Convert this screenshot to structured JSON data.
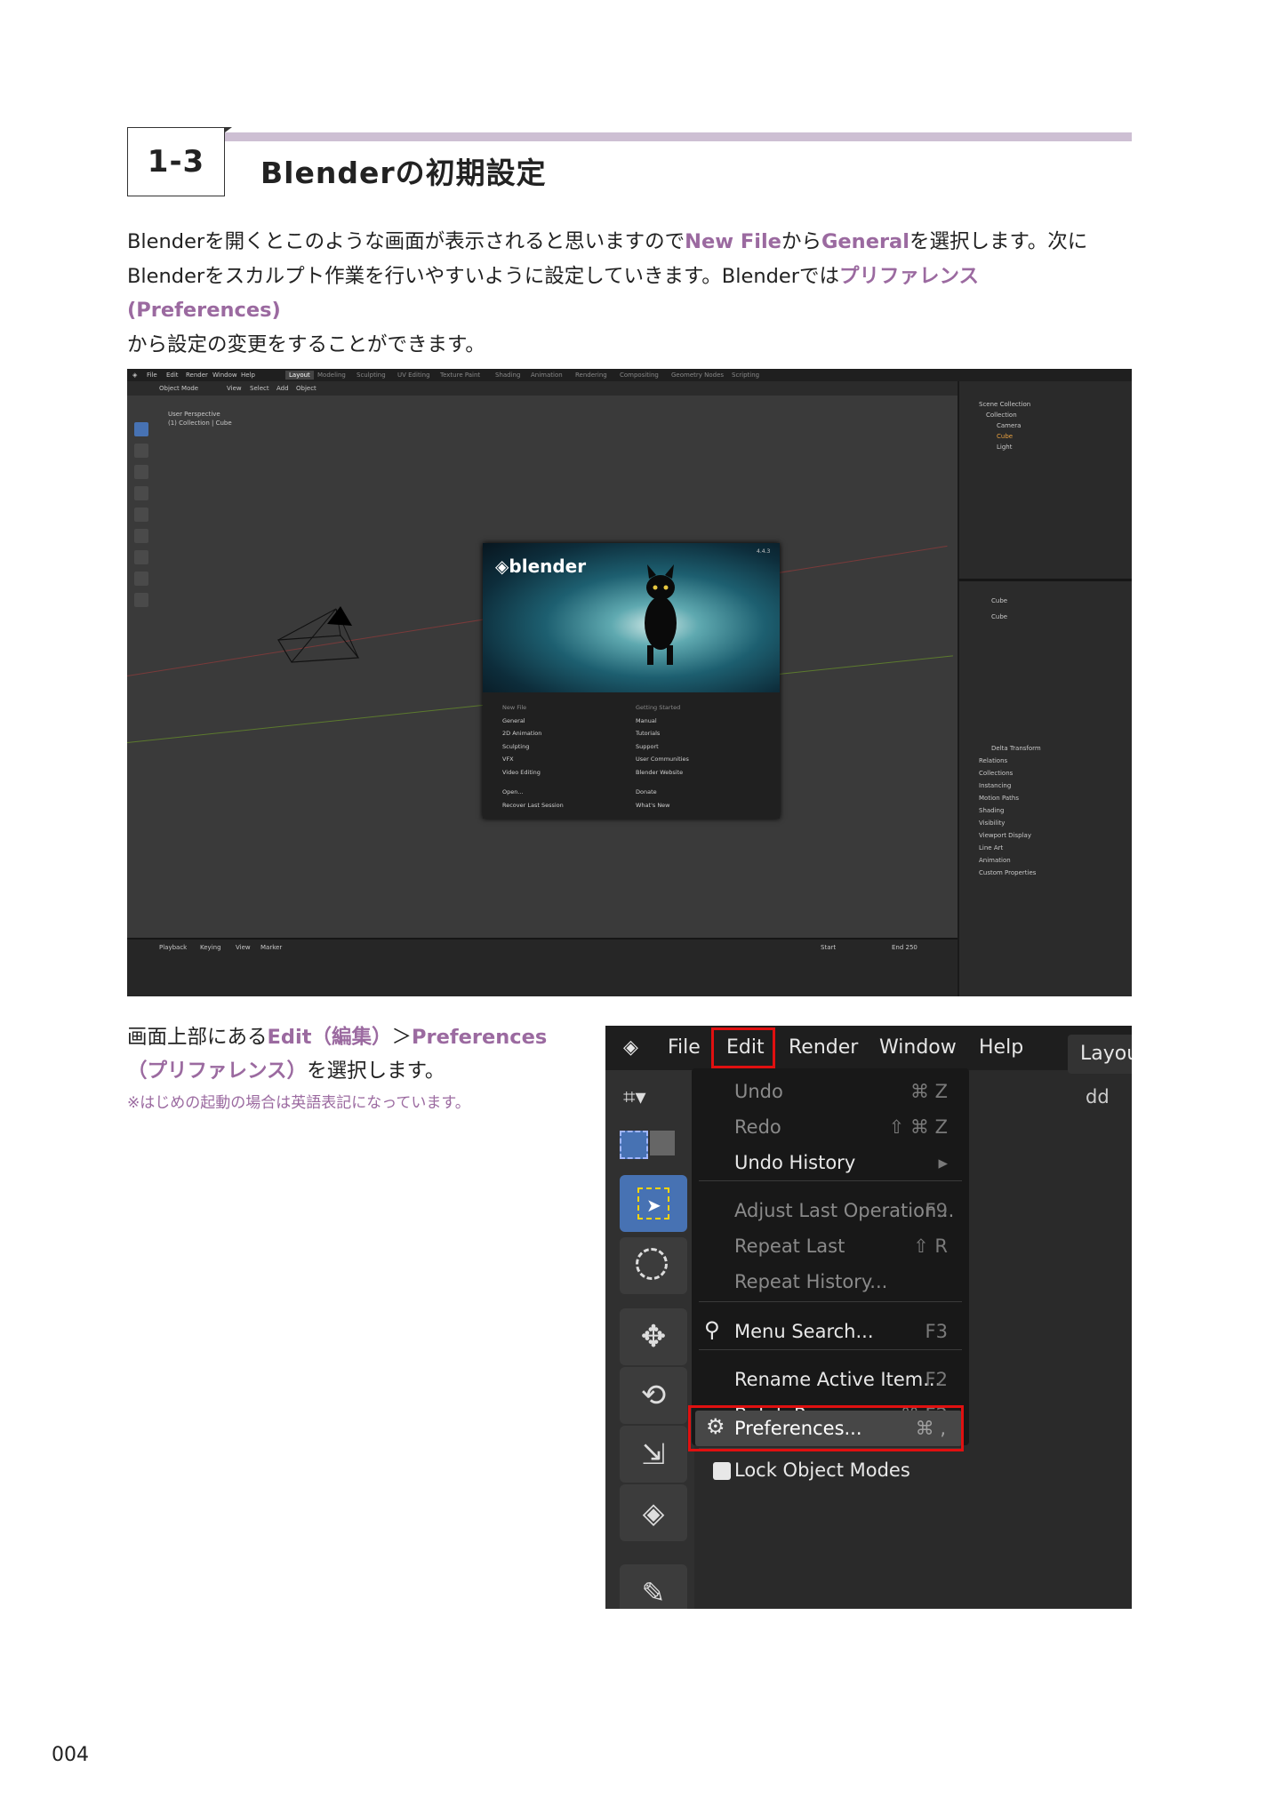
{
  "section": {
    "number": "1-3",
    "title": "Blenderの初期設定"
  },
  "intro": {
    "t1": "Blenderを開くとこのような画面が表示されると思いますので",
    "h1": "New File",
    "t2": "から",
    "h2": "General",
    "t3": "を選択します。次にBlenderをスカルプト作業を行いやすいように設定していきます。Blenderでは",
    "h3": "プリファレンス(Preferences)",
    "t4": "から設定の変更をすることができます。"
  },
  "screenshot1": {
    "topbar_menus": [
      "File",
      "Edit",
      "Render",
      "Window",
      "Help"
    ],
    "workspace_tabs": [
      "Layout",
      "Modeling",
      "Sculpting",
      "UV Editing",
      "Texture Paint",
      "Shading",
      "Animation",
      "Rendering",
      "Compositing",
      "Geometry Nodes",
      "Scripting"
    ],
    "header_items": [
      "Object Mode",
      "View",
      "Select",
      "Add",
      "Object"
    ],
    "viewport_label_1": "User Perspective",
    "viewport_label_2": "(1) Collection | Cube",
    "splash_logo": "blender",
    "splash_version": "4.4.3",
    "splash_new_file_heading": "New File",
    "splash_new_file": [
      "General",
      "2D Animation",
      "Sculpting",
      "VFX",
      "Video Editing"
    ],
    "splash_open": [
      "Open...",
      "Recover Last Session"
    ],
    "splash_getting_started_heading": "Getting Started",
    "splash_getting_started": [
      "Manual",
      "Tutorials",
      "Support",
      "User Communities",
      "Blender Website"
    ],
    "splash_extra": [
      "Donate",
      "What's New"
    ],
    "outliner": [
      "Scene Collection",
      "Collection",
      "Camera",
      "Cube",
      "Light"
    ],
    "props_object": "Cube",
    "props_panels": [
      "Delta Transform",
      "Relations",
      "Collections",
      "Instancing",
      "Motion Paths",
      "Shading",
      "Visibility",
      "Viewport Display",
      "Line Art",
      "Animation",
      "Custom Properties"
    ],
    "timeline_items": [
      "Playback",
      "Keying",
      "View",
      "Marker"
    ],
    "timeline_start": "Start",
    "timeline_end": "End 250"
  },
  "para2": {
    "t1": "画面上部にある",
    "h1": "Edit",
    "h2": "（編集）",
    "t2": "＞",
    "h3": "Preferences",
    "h4": "（プリファレンス）",
    "t3": "を選択します。",
    "note": "※はじめの起動の場合は英語表記になっています。"
  },
  "screenshot2": {
    "menubar": [
      "File",
      "Edit",
      "Render",
      "Window",
      "Help"
    ],
    "layout_tab": "Layou",
    "partial_text": "dd",
    "menu": [
      {
        "label": "Undo",
        "shortcut": "⌘ Z",
        "dim": true
      },
      {
        "label": "Redo",
        "shortcut": "⇧ ⌘ Z",
        "dim": true
      },
      {
        "label": "Undo History",
        "shortcut": "▸",
        "dim": false
      },
      {
        "label": "Adjust Last Operation...",
        "shortcut": "F9",
        "dim": true
      },
      {
        "label": "Repeat Last",
        "shortcut": "⇧ R",
        "dim": true
      },
      {
        "label": "Repeat History...",
        "shortcut": "",
        "dim": true
      },
      {
        "label": "Menu Search...",
        "shortcut": "F3",
        "dim": false
      },
      {
        "label": "Rename Active Item...",
        "shortcut": "F2",
        "dim": false
      },
      {
        "label": "Batch Rename...",
        "shortcut": "⌘ F2",
        "dim": false
      },
      {
        "label": "Lock Object Modes",
        "shortcut": "",
        "dim": false
      },
      {
        "label": "Preferences...",
        "shortcut": "⌘ ,",
        "dim": false
      }
    ],
    "highlight_color": "#e01010"
  },
  "page_number": "004",
  "accent_color": "#9b6aa0"
}
